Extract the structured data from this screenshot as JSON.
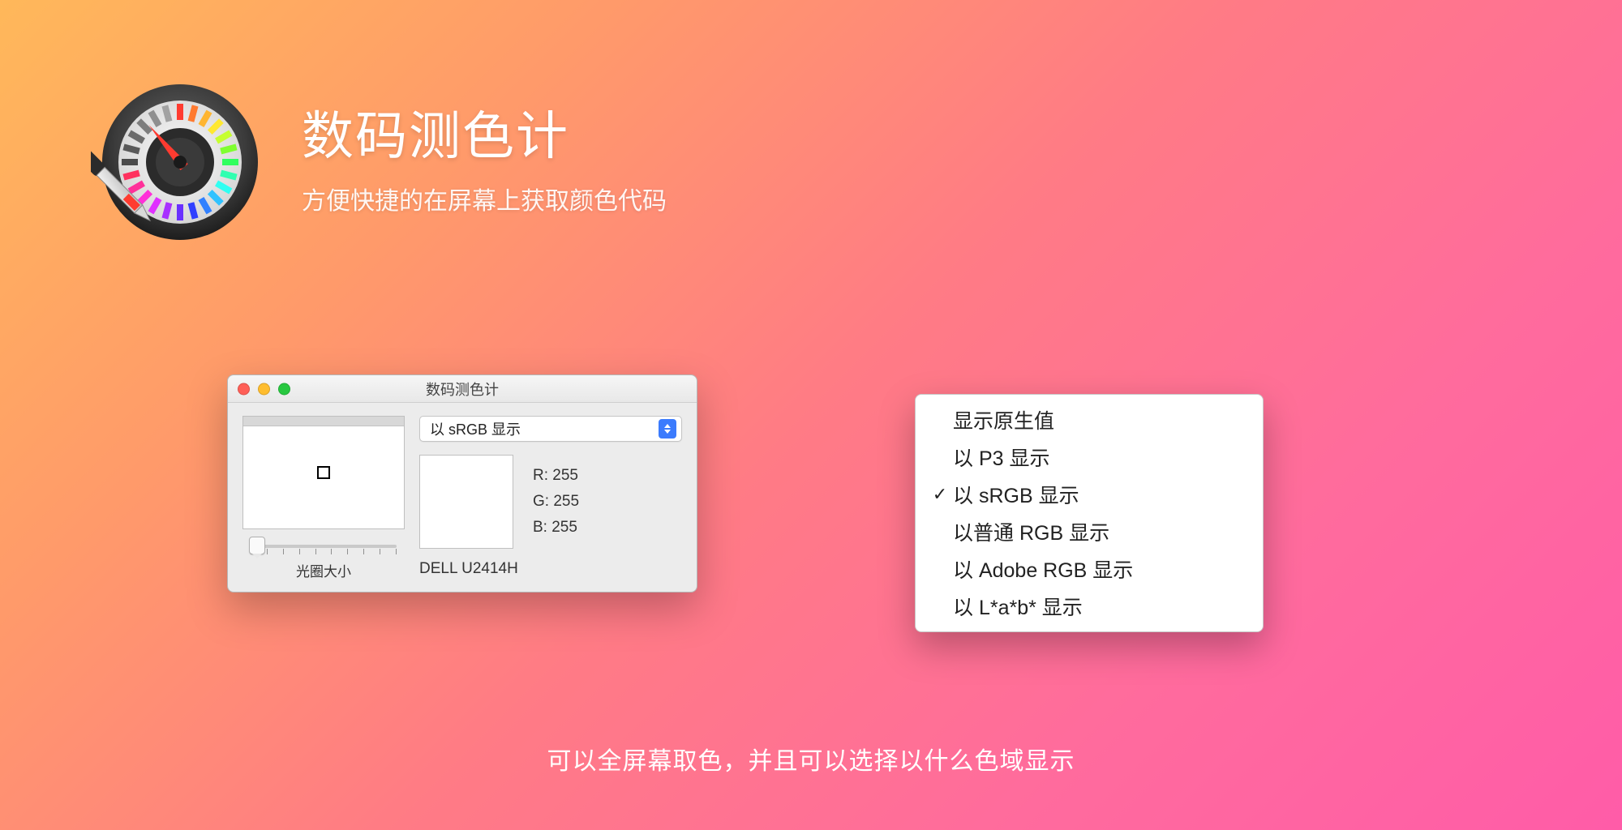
{
  "header": {
    "title": "数码测色计",
    "subtitle": "方便快捷的在屏幕上获取颜色代码"
  },
  "window": {
    "title": "数码测色计",
    "dropdown_label": "以 sRGB 显示",
    "slider_label": "光圈大小",
    "r_label": "R:",
    "g_label": "G:",
    "b_label": "B:",
    "r_value": "255",
    "g_value": "255",
    "b_value": "255",
    "display_name": "DELL U2414H"
  },
  "menu": {
    "items": [
      {
        "label": "显示原生值",
        "checked": false
      },
      {
        "label": "以 P3 显示",
        "checked": false
      },
      {
        "label": "以 sRGB 显示",
        "checked": true
      },
      {
        "label": "以普通 RGB 显示",
        "checked": false
      },
      {
        "label": "以 Adobe RGB 显示",
        "checked": false
      },
      {
        "label": "以 L*a*b* 显示",
        "checked": false
      }
    ]
  },
  "caption": "可以全屏幕取色，并且可以选择以什么色域显示"
}
